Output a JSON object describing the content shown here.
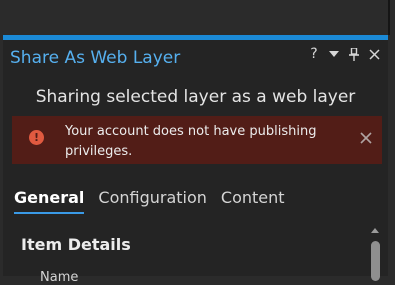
{
  "pane": {
    "title": "Share As Web Layer",
    "header_icons": [
      "help-icon",
      "dropdown-arrow-icon",
      "pin-icon",
      "close-icon"
    ],
    "help_glyph": "?"
  },
  "subtitle": "Sharing selected layer as a web layer",
  "banner": {
    "message": "Your account does not have publishing privileges.",
    "icon": "error-icon",
    "icon_glyph": "!"
  },
  "tabs": [
    {
      "label": "General",
      "active": true
    },
    {
      "label": "Configuration",
      "active": false
    },
    {
      "label": "Content",
      "active": false
    }
  ],
  "section": {
    "title": "Item Details",
    "first_field_label": "Name"
  },
  "colors": {
    "accent": "#1b8ad6",
    "title_text": "#56b0ef",
    "banner_bg": "#521d17",
    "error_icon": "#e05a40"
  }
}
